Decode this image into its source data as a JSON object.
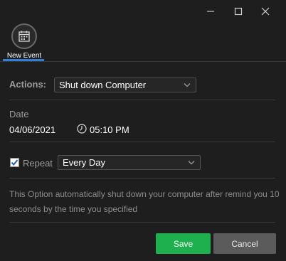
{
  "window": {
    "minimize_icon": "minimize-icon",
    "maximize_icon": "maximize-icon",
    "close_icon": "close-icon"
  },
  "toolbar": {
    "new_event_label": "New Event",
    "new_event_icon": "calendar-icon",
    "accent_color": "#2f7fd7"
  },
  "form": {
    "actions_label": "Actions:",
    "actions_value": "Shut down Computer",
    "date_label": "Date",
    "date_value": "04/06/2021",
    "time_value": "05:10 PM",
    "repeat_checked": true,
    "repeat_label": "Repeat",
    "repeat_value": "Every Day",
    "description": "This Option automatically shut down your computer after remind you 10 seconds by the time you specified"
  },
  "buttons": {
    "save_label": "Save",
    "save_color": "#1eb04e",
    "cancel_label": "Cancel",
    "cancel_color": "#5b5b5b"
  }
}
